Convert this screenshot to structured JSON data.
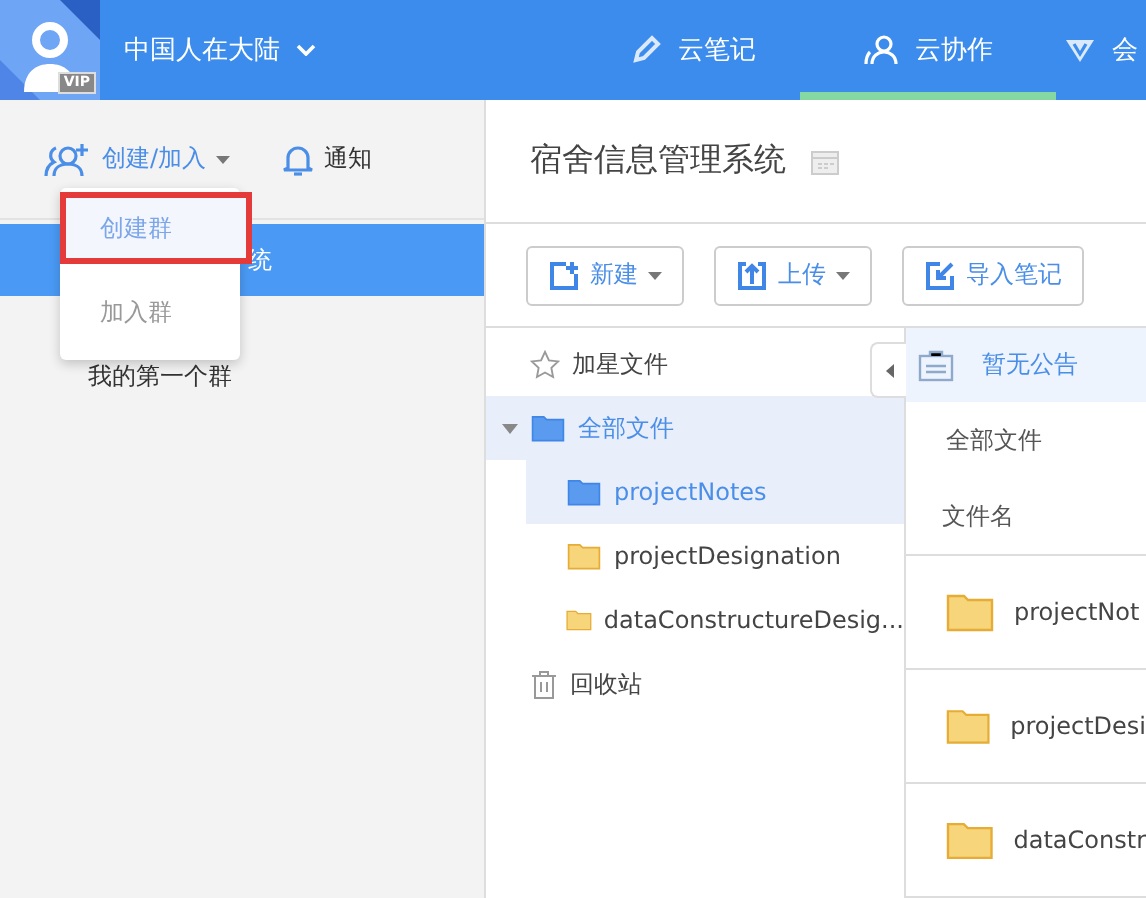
{
  "header": {
    "user": "中国人在大陆",
    "vip": "VIP",
    "nav": [
      {
        "label": "云笔记",
        "selected": false
      },
      {
        "label": "云协作",
        "selected": true
      },
      {
        "label": "会",
        "selected": false
      }
    ]
  },
  "sidebar": {
    "actions": [
      {
        "label": "创建/加入",
        "caret": true
      },
      {
        "label": "通知",
        "caret": false
      }
    ],
    "groups": [
      {
        "label": "统",
        "selected": true
      },
      {
        "label": "我的第一个群",
        "selected": false
      }
    ],
    "menu": [
      {
        "label": "创建群",
        "highlighted": true
      },
      {
        "label": "加入群",
        "highlighted": false
      }
    ]
  },
  "main": {
    "title": "宿舍信息管理系统",
    "toolbar": [
      {
        "label": "新建",
        "caret": true
      },
      {
        "label": "上传",
        "caret": true
      },
      {
        "label": "导入笔记",
        "caret": false
      }
    ],
    "tree": [
      {
        "label": "加星文件",
        "kind": "starred",
        "selected": false
      },
      {
        "label": "全部文件",
        "kind": "folder",
        "selected": true,
        "expanded": true,
        "children": [
          {
            "label": "projectNotes",
            "kind": "folder",
            "selected": true
          },
          {
            "label": "projectDesignation",
            "kind": "folder",
            "selected": false
          },
          {
            "label": "dataConstructureDesig...",
            "kind": "folder",
            "selected": false
          }
        ]
      },
      {
        "label": "回收站",
        "kind": "trash",
        "selected": false
      }
    ],
    "notice": "暂无公告",
    "breadcrumb": "全部文件",
    "column": "文件名",
    "files": [
      "projectNot",
      "projectDesi",
      "dataConstr"
    ]
  }
}
